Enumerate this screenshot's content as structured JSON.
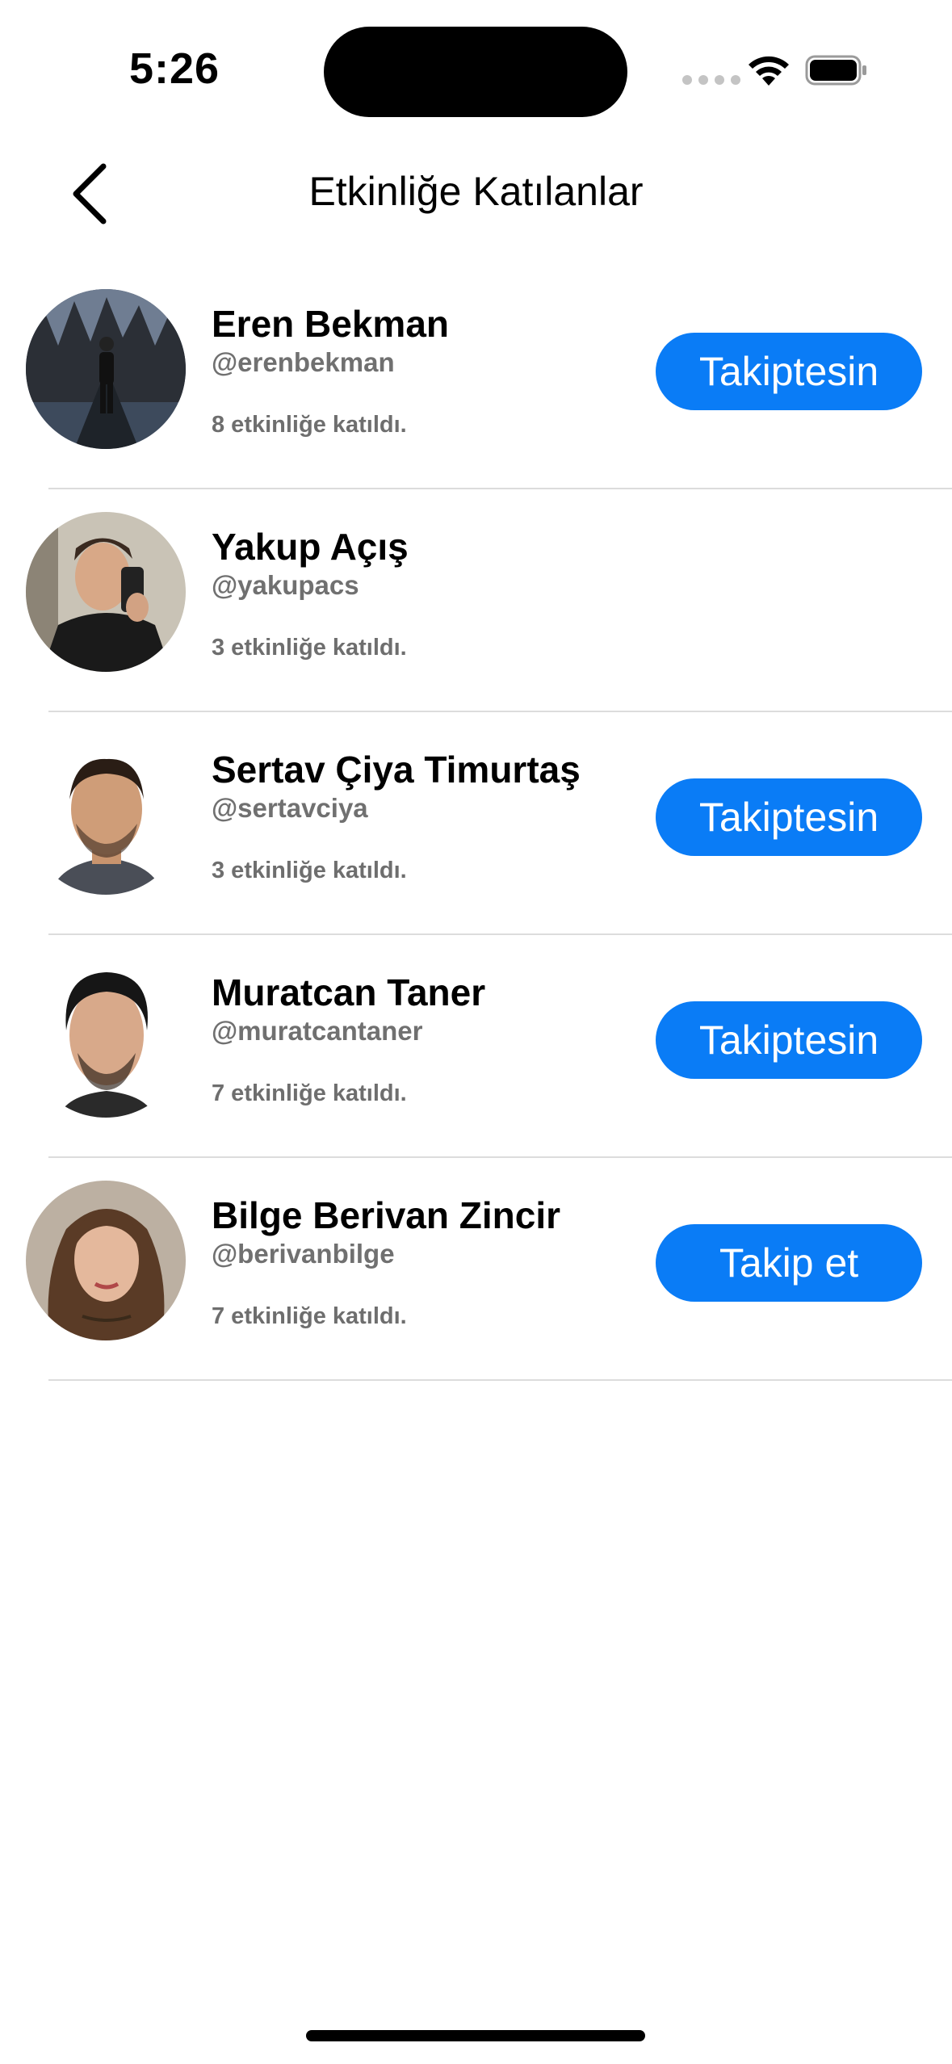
{
  "status_bar": {
    "time": "5:26",
    "wifi_icon": "wifi-icon",
    "battery_icon": "battery-icon"
  },
  "nav": {
    "title": "Etkinliğe Katılanlar",
    "back_icon": "chevron-left-icon"
  },
  "participants": [
    {
      "name": "Eren Bekman",
      "handle": "@erenbekman",
      "events": "8 etkinliğe katıldı.",
      "button": "Takiptesin"
    },
    {
      "name": "Yakup Açış",
      "handle": "@yakupacs",
      "events": "3 etkinliğe katıldı.",
      "button": null
    },
    {
      "name": "Sertav Çiya Timurtaş",
      "handle": "@sertavciya",
      "events": "3 etkinliğe katıldı.",
      "button": "Takiptesin"
    },
    {
      "name": "Muratcan Taner",
      "handle": "@muratcantaner",
      "events": "7 etkinliğe katıldı.",
      "button": "Takiptesin"
    },
    {
      "name": "Bilge Berivan Zincir",
      "handle": "@berivanbilge",
      "events": "7 etkinliğe katıldı.",
      "button": "Takip et"
    }
  ],
  "colors": {
    "accent": "#0a7cf6",
    "secondary_text": "#707070",
    "divider": "#dcdcdc"
  }
}
